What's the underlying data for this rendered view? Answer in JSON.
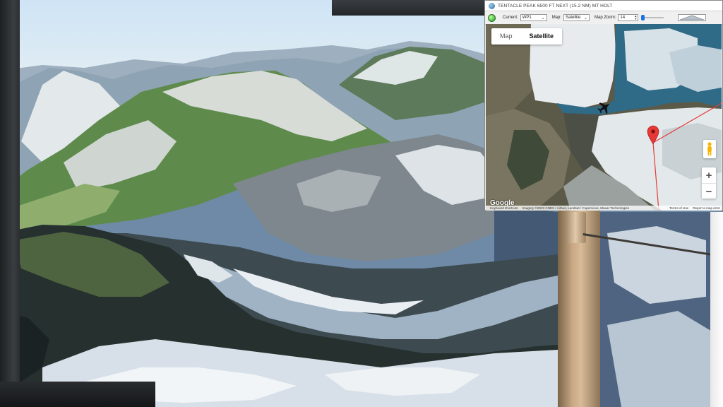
{
  "window": {
    "title": "TENTACLE PEAK 6500 FT NEXT (15.2 NM) MT HOLT",
    "app_icon": "globe-icon"
  },
  "toolbar": {
    "status": "connected",
    "current_label": "Current:",
    "current_value": "WP1",
    "map_label": "Map:",
    "map_value": "Satellite",
    "zoom_label": "Map Zoom:",
    "zoom_value": "14",
    "terrain_profile_icon": "mountain-profile-icon"
  },
  "map": {
    "type_options": [
      "Map",
      "Satellite"
    ],
    "selected_type": "Satellite",
    "zoom_in": "+",
    "zoom_out": "−",
    "logo": "Google",
    "attribution": {
      "shortcuts": "Keyboard shortcuts",
      "imagery": "Imagery ©2023 CNES / Airbus, Landsat / Copernicus, Maxar Technologies",
      "terms": "Terms of Use",
      "report": "Report a map error"
    },
    "marker_color": "#e53935",
    "route_color": "#e53935"
  }
}
